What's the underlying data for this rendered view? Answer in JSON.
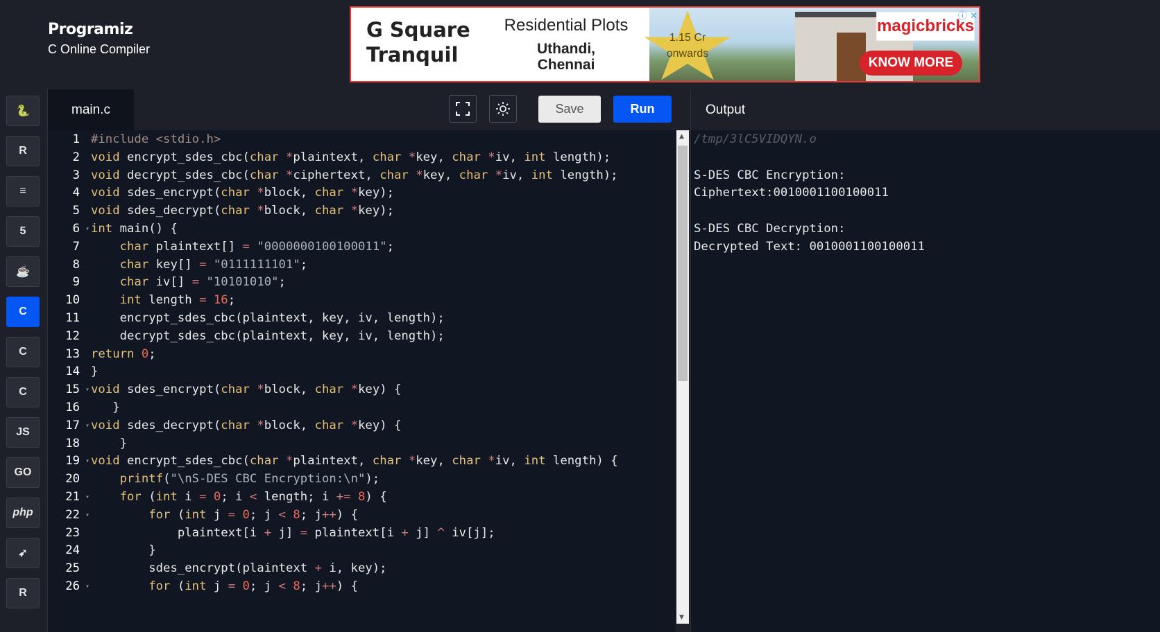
{
  "brand": {
    "logo": "Programiz",
    "subtitle": "C Online Compiler"
  },
  "ad": {
    "title_line1": "G Square",
    "title_line2": "Tranquil",
    "headline": "Residential Plots",
    "location_line1": "Uthandi,",
    "location_line2": "Chennai",
    "price_line1": "1.15 Cr",
    "price_line2": "onwards",
    "logo": "magicbricks",
    "cta": "KNOW MORE",
    "controls": "ⓘ ✕"
  },
  "sidebar": {
    "languages": [
      {
        "name": "python-icon",
        "glyph": "🐍"
      },
      {
        "name": "r-icon",
        "glyph": "R"
      },
      {
        "name": "sql-icon",
        "glyph": "≡"
      },
      {
        "name": "html5-icon",
        "glyph": "5"
      },
      {
        "name": "java-icon",
        "glyph": "☕"
      },
      {
        "name": "c-icon",
        "glyph": "C"
      },
      {
        "name": "cpp-icon",
        "glyph": "C"
      },
      {
        "name": "csharp-icon",
        "glyph": "C"
      },
      {
        "name": "javascript-icon",
        "glyph": "JS"
      },
      {
        "name": "go-icon",
        "glyph": "GO"
      },
      {
        "name": "php-icon",
        "glyph": "php"
      },
      {
        "name": "swift-icon",
        "glyph": "➶"
      },
      {
        "name": "rust-icon",
        "glyph": "R"
      }
    ],
    "active_language": "c"
  },
  "editor": {
    "filename": "main.c",
    "save_label": "Save",
    "run_label": "Run",
    "lines": [
      {
        "n": "1",
        "fold": false,
        "html": "<span class='pp'>#include &lt;stdio.h&gt;</span>"
      },
      {
        "n": "2",
        "fold": false,
        "html": "<span class='kw'>void</span> encrypt_sdes_cbc(<span class='kw'>char</span> <span class='op'>*</span>plaintext, <span class='kw'>char</span> <span class='op'>*</span>key, <span class='kw'>char</span> <span class='op'>*</span>iv, <span class='kw'>int</span> length);"
      },
      {
        "n": "3",
        "fold": false,
        "html": "<span class='kw'>void</span> decrypt_sdes_cbc(<span class='kw'>char</span> <span class='op'>*</span>ciphertext, <span class='kw'>char</span> <span class='op'>*</span>key, <span class='kw'>char</span> <span class='op'>*</span>iv, <span class='kw'>int</span> length);"
      },
      {
        "n": "4",
        "fold": false,
        "html": "<span class='kw'>void</span> sdes_encrypt(<span class='kw'>char</span> <span class='op'>*</span>block, <span class='kw'>char</span> <span class='op'>*</span>key);"
      },
      {
        "n": "5",
        "fold": false,
        "html": "<span class='kw'>void</span> sdes_decrypt(<span class='kw'>char</span> <span class='op'>*</span>block, <span class='kw'>char</span> <span class='op'>*</span>key);"
      },
      {
        "n": "6",
        "fold": true,
        "html": "<span class='kw'>int</span> main() {"
      },
      {
        "n": "7",
        "fold": false,
        "html": "    <span class='kw'>char</span> plaintext[] <span class='op'>=</span> <span class='str'>\"0000000100100011\"</span>;"
      },
      {
        "n": "8",
        "fold": false,
        "html": "    <span class='kw'>char</span> key[] <span class='op'>=</span> <span class='str'>\"0111111101\"</span>;"
      },
      {
        "n": "9",
        "fold": false,
        "html": "    <span class='kw'>char</span> iv[] <span class='op'>=</span> <span class='str'>\"10101010\"</span>;"
      },
      {
        "n": "10",
        "fold": false,
        "html": "    <span class='kw'>int</span> length <span class='op'>=</span> <span class='num'>16</span>;"
      },
      {
        "n": "11",
        "fold": false,
        "html": "    encrypt_sdes_cbc(plaintext, key, iv, length);"
      },
      {
        "n": "12",
        "fold": false,
        "html": "    decrypt_sdes_cbc(plaintext, key, iv, length);"
      },
      {
        "n": "13",
        "fold": false,
        "html": "<span class='kw'>return</span> <span class='num'>0</span>;"
      },
      {
        "n": "14",
        "fold": false,
        "html": "}"
      },
      {
        "n": "15",
        "fold": true,
        "html": "<span class='kw'>void</span> sdes_encrypt(<span class='kw'>char</span> <span class='op'>*</span>block, <span class='kw'>char</span> <span class='op'>*</span>key) {"
      },
      {
        "n": "16",
        "fold": false,
        "html": "   }"
      },
      {
        "n": "17",
        "fold": true,
        "html": "<span class='kw'>void</span> sdes_decrypt(<span class='kw'>char</span> <span class='op'>*</span>block, <span class='kw'>char</span> <span class='op'>*</span>key) {"
      },
      {
        "n": "18",
        "fold": false,
        "html": "    }"
      },
      {
        "n": "19",
        "fold": true,
        "html": "<span class='kw'>void</span> encrypt_sdes_cbc(<span class='kw'>char</span> <span class='op'>*</span>plaintext, <span class='kw'>char</span> <span class='op'>*</span>key, <span class='kw'>char</span> <span class='op'>*</span>iv, <span class='kw'>int</span> length) {"
      },
      {
        "n": "20",
        "fold": false,
        "html": "    <span class='kw'>printf</span>(<span class='str'>\"\\nS-DES CBC Encryption:\\n\"</span>);"
      },
      {
        "n": "21",
        "fold": true,
        "html": "    <span class='kw'>for</span> (<span class='kw'>int</span> i <span class='op'>=</span> <span class='num'>0</span>; i <span class='op'>&lt;</span> length; i <span class='op'>+=</span> <span class='num'>8</span>) {"
      },
      {
        "n": "22",
        "fold": true,
        "html": "        <span class='kw'>for</span> (<span class='kw'>int</span> j <span class='op'>=</span> <span class='num'>0</span>; j <span class='op'>&lt;</span> <span class='num'>8</span>; j<span class='op'>++</span>) {"
      },
      {
        "n": "23",
        "fold": false,
        "html": "            plaintext[i <span class='op'>+</span> j] <span class='op'>=</span> plaintext[i <span class='op'>+</span> j] <span class='op'>^</span> iv[j];"
      },
      {
        "n": "24",
        "fold": false,
        "html": "        }"
      },
      {
        "n": "25",
        "fold": false,
        "html": "        sdes_encrypt(plaintext <span class='op'>+</span> i, key);"
      },
      {
        "n": "26",
        "fold": true,
        "html": "        <span class='kw'>for</span> (<span class='kw'>int</span> j <span class='op'>=</span> <span class='num'>0</span>; j <span class='op'>&lt;</span> <span class='num'>8</span>; j<span class='op'>++</span>) {"
      }
    ]
  },
  "output": {
    "title": "Output",
    "lines": [
      {
        "text": "/tmp/3lC5VIDQYN.o",
        "style": "path"
      },
      {
        "text": "",
        "style": "plain"
      },
      {
        "text": "S-DES CBC Encryption:",
        "style": "plain"
      },
      {
        "text": "Ciphertext:0010001100100011",
        "style": "plain"
      },
      {
        "text": "",
        "style": "plain"
      },
      {
        "text": "S-DES CBC Decryption:",
        "style": "plain"
      },
      {
        "text": "Decrypted Text: 0010001100100011",
        "style": "plain"
      }
    ]
  },
  "colors": {
    "run": "#0556f3",
    "active_lang": "#0556f3",
    "ad_red": "#d8232a"
  }
}
